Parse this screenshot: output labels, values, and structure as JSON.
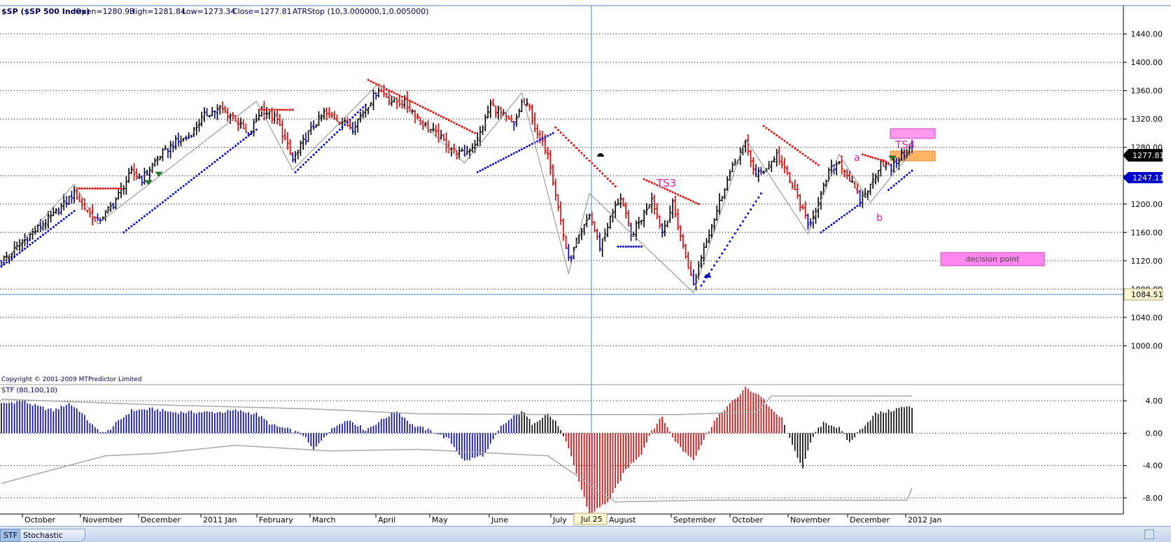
{
  "header": {
    "symbol": "$SP ($SP 500 Index)",
    "open": "Open=1280.93",
    "high": "High=1281.84",
    "low": "Low=1273.34",
    "close": "Close=1277.81",
    "indicator": "ATRStop (10,3.000000,1,0.005000)"
  },
  "copyright": "Copyright © 2001-2009 MTPredictor Limited",
  "lower_title": "STF (80,100,10)",
  "price_tags": {
    "close": "1277.81",
    "stop": "1247.11",
    "hline": "1084.51"
  },
  "annotations": {
    "ts3": "TS3",
    "ts4": "TS4",
    "a": "a",
    "b": "b",
    "decision_point": "decision point"
  },
  "crosshair_date": "Jul 25",
  "tabs": {
    "stf": "STF",
    "stochastic": "Stochastic"
  },
  "colors": {
    "up_bar": "#000000",
    "red_bar": "#e00000",
    "blue_bar": "#0000cc",
    "stop_red": "#ff0000",
    "stop_blue": "#0000ff",
    "annotation": "#e0219a",
    "box_pink": "#ff88ee",
    "box_orange": "#ffb060",
    "grid": "#000000",
    "band": "#a8a8a8",
    "crosshair": "#4f86c6",
    "hline": "#4f86c6"
  },
  "chart_data": [
    {
      "type": "candlestick",
      "title": "$SP ($SP 500 Index)",
      "ylim": [
        960,
        1480
      ],
      "y_ticks": [
        1000,
        1040,
        1080,
        1120,
        1160,
        1200,
        1240,
        1280,
        1320,
        1360,
        1400,
        1440
      ],
      "x_labels": [
        "October",
        "November",
        "December",
        "2011 Jan",
        "February",
        "March",
        "April",
        "May",
        "June",
        "July",
        "Jul 25",
        "August",
        "September",
        "October",
        "November",
        "December",
        "2012 Jan"
      ],
      "horizontal_line": 1084.51,
      "last_close": 1277.81,
      "current_stop": 1247.11,
      "price_path": [
        [
          0,
          1120
        ],
        [
          5,
          1135
        ],
        [
          12,
          1160
        ],
        [
          20,
          1185
        ],
        [
          28,
          1215
        ],
        [
          32,
          1195
        ],
        [
          37,
          1175
        ],
        [
          43,
          1200
        ],
        [
          50,
          1245
        ],
        [
          54,
          1235
        ],
        [
          60,
          1265
        ],
        [
          66,
          1285
        ],
        [
          72,
          1295
        ],
        [
          78,
          1325
        ],
        [
          84,
          1335
        ],
        [
          90,
          1320
        ],
        [
          95,
          1295
        ],
        [
          100,
          1335
        ],
        [
          106,
          1318
        ],
        [
          112,
          1262
        ],
        [
          118,
          1300
        ],
        [
          124,
          1328
        ],
        [
          130,
          1318
        ],
        [
          135,
          1308
        ],
        [
          140,
          1335
        ],
        [
          145,
          1363
        ],
        [
          150,
          1345
        ],
        [
          155,
          1343
        ],
        [
          162,
          1315
        ],
        [
          168,
          1295
        ],
        [
          174,
          1275
        ],
        [
          178,
          1270
        ],
        [
          183,
          1290
        ],
        [
          188,
          1340
        ],
        [
          192,
          1328
        ],
        [
          197,
          1310
        ],
        [
          200,
          1343
        ],
        [
          203,
          1335
        ],
        [
          206,
          1295
        ],
        [
          210,
          1275
        ],
        [
          214,
          1195
        ],
        [
          218,
          1120
        ],
        [
          222,
          1150
        ],
        [
          226,
          1185
        ],
        [
          230,
          1140
        ],
        [
          234,
          1180
        ],
        [
          238,
          1210
        ],
        [
          242,
          1155
        ],
        [
          246,
          1180
        ],
        [
          250,
          1210
        ],
        [
          254,
          1160
        ],
        [
          258,
          1200
        ],
        [
          262,
          1140
        ],
        [
          266,
          1085
        ],
        [
          270,
          1140
        ],
        [
          274,
          1180
        ],
        [
          278,
          1225
        ],
        [
          282,
          1260
        ],
        [
          286,
          1285
        ],
        [
          290,
          1240
        ],
        [
          294,
          1250
        ],
        [
          298,
          1270
        ],
        [
          302,
          1240
        ],
        [
          306,
          1210
        ],
        [
          310,
          1170
        ],
        [
          314,
          1200
        ],
        [
          318,
          1245
        ],
        [
          322,
          1260
        ],
        [
          326,
          1235
        ],
        [
          330,
          1205
        ],
        [
          334,
          1225
        ],
        [
          338,
          1260
        ],
        [
          342,
          1250
        ],
        [
          346,
          1268
        ],
        [
          350,
          1280
        ]
      ],
      "stop_segments": [
        {
          "color": "blue",
          "from": 0,
          "to": 28,
          "start": 1112,
          "end": 1190
        },
        {
          "color": "red",
          "from": 29,
          "to": 46,
          "start": 1222,
          "end": 1222
        },
        {
          "color": "blue",
          "from": 47,
          "to": 98,
          "start": 1160,
          "end": 1305
        },
        {
          "color": "red",
          "from": 99,
          "to": 112,
          "start": 1333,
          "end": 1333
        },
        {
          "color": "blue",
          "from": 113,
          "to": 140,
          "start": 1245,
          "end": 1340
        },
        {
          "color": "red",
          "from": 141,
          "to": 182,
          "start": 1375,
          "end": 1300
        },
        {
          "color": "blue",
          "from": 183,
          "to": 212,
          "start": 1245,
          "end": 1300
        },
        {
          "color": "red",
          "from": 213,
          "to": 236,
          "start": 1308,
          "end": 1225
        },
        {
          "color": "blue",
          "from": 237,
          "to": 246,
          "start": 1140,
          "end": 1140
        },
        {
          "color": "red",
          "from": 247,
          "to": 268,
          "start": 1235,
          "end": 1200
        },
        {
          "color": "blue",
          "from": 269,
          "to": 292,
          "start": 1085,
          "end": 1215
        },
        {
          "color": "red",
          "from": 293,
          "to": 314,
          "start": 1310,
          "end": 1255
        },
        {
          "color": "blue",
          "from": 315,
          "to": 330,
          "start": 1160,
          "end": 1200
        },
        {
          "color": "red",
          "from": 331,
          "to": 340,
          "start": 1270,
          "end": 1260
        },
        {
          "color": "blue",
          "from": 341,
          "to": 350,
          "start": 1220,
          "end": 1247
        }
      ]
    },
    {
      "type": "bar",
      "title": "STF (80,100,10)",
      "ylim": [
        -10,
        6
      ],
      "y_ticks": [
        4.0,
        0.0,
        -4.0,
        -8.0
      ],
      "color_runs": [
        {
          "color": "black",
          "from": 0,
          "to": 0
        },
        {
          "color": "blue",
          "from": 1,
          "to": 198
        },
        {
          "color": "black",
          "from": 199,
          "to": 216
        },
        {
          "color": "red",
          "from": 217,
          "to": 278
        },
        {
          "color": "red",
          "from": 279,
          "to": 300
        },
        {
          "color": "black",
          "from": 301,
          "to": 350
        }
      ],
      "value_path": [
        [
          0,
          3.6
        ],
        [
          8,
          4.0
        ],
        [
          14,
          3.3
        ],
        [
          20,
          2.8
        ],
        [
          26,
          3.7
        ],
        [
          30,
          2.8
        ],
        [
          36,
          0.6
        ],
        [
          40,
          0.0
        ],
        [
          44,
          1.2
        ],
        [
          50,
          2.8
        ],
        [
          58,
          3.0
        ],
        [
          66,
          2.6
        ],
        [
          74,
          2.6
        ],
        [
          84,
          2.6
        ],
        [
          90,
          2.8
        ],
        [
          98,
          2.4
        ],
        [
          104,
          1.0
        ],
        [
          110,
          0.5
        ],
        [
          116,
          -0.2
        ],
        [
          120,
          -2.2
        ],
        [
          124,
          -0.4
        ],
        [
          130,
          1.3
        ],
        [
          134,
          1.6
        ],
        [
          140,
          0.4
        ],
        [
          146,
          1.6
        ],
        [
          152,
          2.8
        ],
        [
          158,
          1.0
        ],
        [
          166,
          0.2
        ],
        [
          172,
          -0.8
        ],
        [
          178,
          -3.5
        ],
        [
          186,
          -2.6
        ],
        [
          192,
          0.8
        ],
        [
          200,
          2.8
        ],
        [
          204,
          1.2
        ],
        [
          210,
          2.4
        ],
        [
          214,
          1.0
        ],
        [
          218,
          -2.0
        ],
        [
          222,
          -6.0
        ],
        [
          226,
          -10.0
        ],
        [
          230,
          -9.2
        ],
        [
          234,
          -8.2
        ],
        [
          240,
          -4.5
        ],
        [
          246,
          -2.5
        ],
        [
          250,
          0.4
        ],
        [
          254,
          2.0
        ],
        [
          258,
          -0.5
        ],
        [
          262,
          -2.2
        ],
        [
          266,
          -3.2
        ],
        [
          270,
          -0.8
        ],
        [
          274,
          1.5
        ],
        [
          278,
          3.0
        ],
        [
          282,
          4.2
        ],
        [
          286,
          5.6
        ],
        [
          292,
          4.6
        ],
        [
          296,
          2.8
        ],
        [
          300,
          1.8
        ],
        [
          304,
          -1.6
        ],
        [
          308,
          -4.2
        ],
        [
          312,
          -0.4
        ],
        [
          316,
          1.4
        ],
        [
          322,
          0.6
        ],
        [
          326,
          -1.2
        ],
        [
          330,
          0.4
        ],
        [
          336,
          2.4
        ],
        [
          342,
          2.8
        ],
        [
          346,
          3.2
        ],
        [
          350,
          3.2
        ]
      ],
      "upper_band": [
        [
          0,
          4.2
        ],
        [
          60,
          3.5
        ],
        [
          120,
          3.0
        ],
        [
          160,
          2.4
        ],
        [
          210,
          2.3
        ],
        [
          260,
          2.3
        ],
        [
          290,
          2.6
        ],
        [
          296,
          4.6
        ],
        [
          350,
          4.6
        ]
      ],
      "lower_band": [
        [
          0,
          -6.2
        ],
        [
          20,
          -4.5
        ],
        [
          40,
          -2.8
        ],
        [
          60,
          -2.5
        ],
        [
          90,
          -1.5
        ],
        [
          126,
          -2.2
        ],
        [
          160,
          -2.0
        ],
        [
          210,
          -2.8
        ],
        [
          236,
          -8.5
        ],
        [
          270,
          -8.3
        ],
        [
          348,
          -8.3
        ],
        [
          350,
          -6.8
        ]
      ]
    }
  ]
}
